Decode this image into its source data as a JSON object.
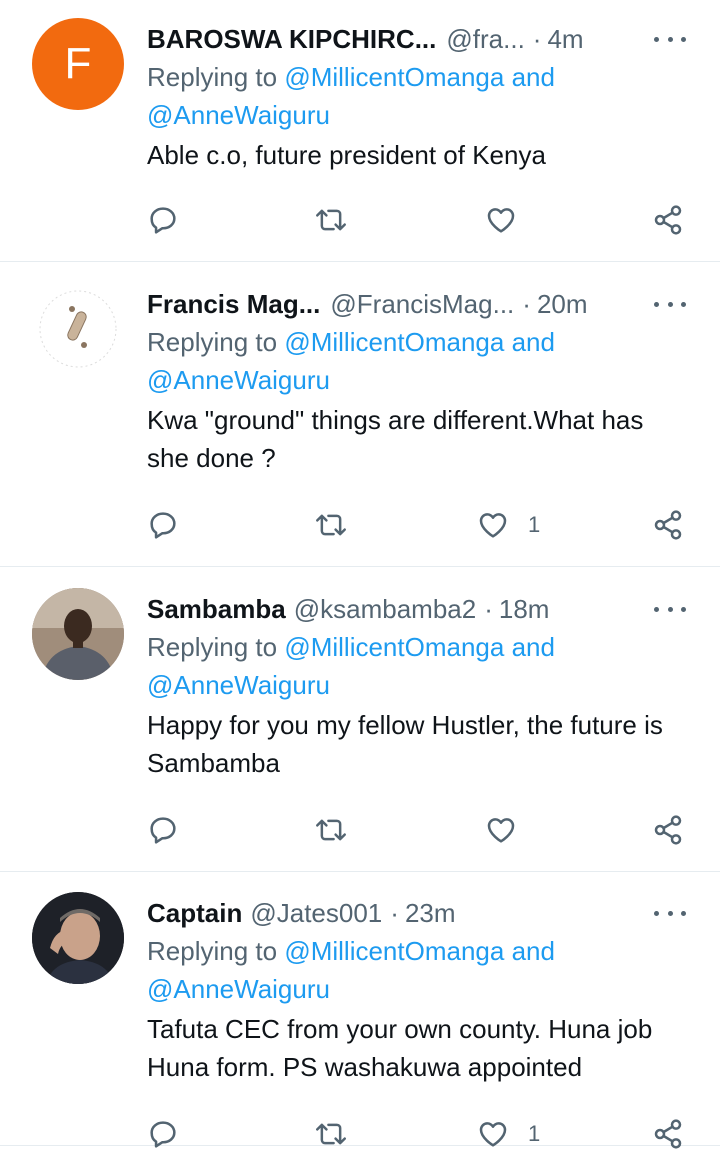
{
  "tweets": [
    {
      "avatar_letter": "F",
      "name": "BAROSWA KIPCHIRC...",
      "handle": "@fra...",
      "time": "4m",
      "reply_prefix": "Replying to ",
      "mention1": "@MillicentOmanga",
      "and": " and",
      "mention2": "@AnneWaiguru",
      "text": "Able c.o, future president of Kenya",
      "likes": ""
    },
    {
      "name": "Francis Mag...",
      "handle": "@FrancisMag...",
      "time": "20m",
      "reply_prefix": "Replying to ",
      "mention1": "@MillicentOmanga",
      "and": " and",
      "mention2": "@AnneWaiguru",
      "text": "Kwa \"ground\" things are different.What has she done ?",
      "likes": "1"
    },
    {
      "name": "Sambamba",
      "handle": "@ksambamba2",
      "time": "18m",
      "reply_prefix": "Replying to ",
      "mention1": "@MillicentOmanga",
      "and": " and",
      "mention2": "@AnneWaiguru",
      "text": "Happy for you my fellow Hustler, the future is Sambamba",
      "likes": ""
    },
    {
      "name": "Captain",
      "handle": "@Jates001",
      "time": "23m",
      "reply_prefix": "Replying to ",
      "mention1": "@MillicentOmanga",
      "and": " and",
      "mention2": "@AnneWaiguru",
      "text": "Tafuta CEC from your own county. Huna job Huna form. PS washakuwa appointed",
      "likes": "1"
    }
  ],
  "colors": {
    "accent": "#1d9bf0",
    "secondary_text": "#536471",
    "avatar_orange": "#f26a0f"
  },
  "icons": [
    "reply-icon",
    "retweet-icon",
    "like-icon",
    "share-icon",
    "more-icon"
  ]
}
